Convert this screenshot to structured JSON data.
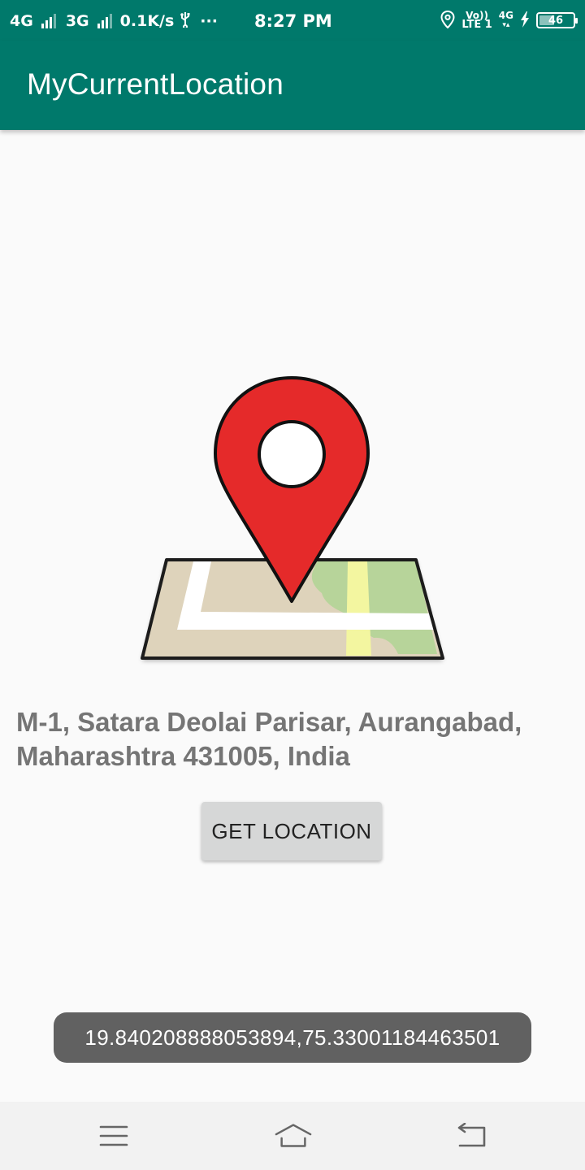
{
  "status_bar": {
    "net1": "4G",
    "net2": "3G",
    "speed": "0.1K/s",
    "usb_icon": "usb-icon",
    "more": "···",
    "time": "8:27 PM",
    "location_icon": "location-icon",
    "volte_top": "Vo))",
    "volte_bottom": "LTE 1",
    "net3": "4G",
    "charging_icon": "bolt-icon",
    "battery": "46"
  },
  "app_bar": {
    "title": "MyCurrentLocation"
  },
  "main": {
    "illustration_icon": "map-pin-icon",
    "address": "M-1, Satara Deolai Parisar, Aurangabad, Maharashtra 431005, India",
    "get_location_button": "GET LOCATION"
  },
  "toast": {
    "text": "19.840208888053894,75.33001184463501"
  },
  "nav_bar": {
    "menu_icon": "menu-icon",
    "home_icon": "home-icon",
    "back_icon": "back-icon"
  },
  "colors": {
    "primary": "#00796b",
    "pin_red": "#e52a2a",
    "background": "#fafafa",
    "button": "#d6d7d7",
    "toast": "#616161",
    "address_text": "#757575"
  }
}
